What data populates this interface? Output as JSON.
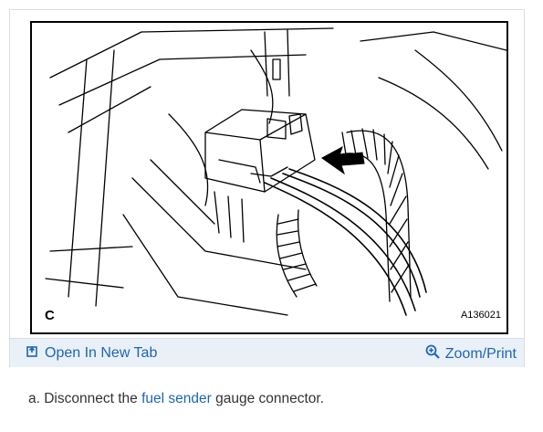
{
  "figure": {
    "letter": "C",
    "code": "A136021"
  },
  "actions": {
    "open_new_tab": "Open In New Tab",
    "zoom_print": "Zoom/Print"
  },
  "step": {
    "prefix": "a. Disconnect the ",
    "link": "fuel sender",
    "suffix": " gauge connector."
  },
  "colors": {
    "link": "#1d66b5",
    "action_bar_bg": "#e9f0f7"
  }
}
